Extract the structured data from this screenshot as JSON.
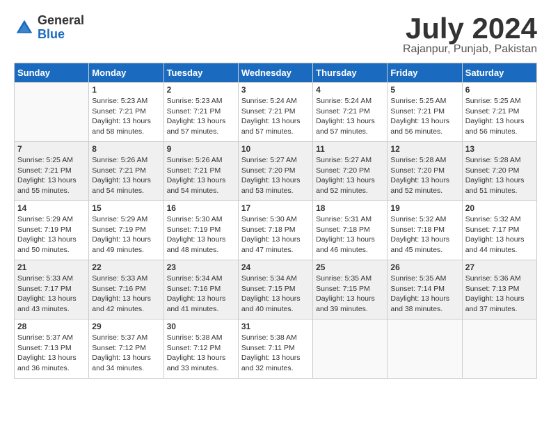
{
  "logo": {
    "general": "General",
    "blue": "Blue"
  },
  "title": {
    "month_year": "July 2024",
    "location": "Rajanpur, Punjab, Pakistan"
  },
  "days_of_week": [
    "Sunday",
    "Monday",
    "Tuesday",
    "Wednesday",
    "Thursday",
    "Friday",
    "Saturday"
  ],
  "weeks": [
    [
      {
        "day": "",
        "info": ""
      },
      {
        "day": "1",
        "info": "Sunrise: 5:23 AM\nSunset: 7:21 PM\nDaylight: 13 hours\nand 58 minutes."
      },
      {
        "day": "2",
        "info": "Sunrise: 5:23 AM\nSunset: 7:21 PM\nDaylight: 13 hours\nand 57 minutes."
      },
      {
        "day": "3",
        "info": "Sunrise: 5:24 AM\nSunset: 7:21 PM\nDaylight: 13 hours\nand 57 minutes."
      },
      {
        "day": "4",
        "info": "Sunrise: 5:24 AM\nSunset: 7:21 PM\nDaylight: 13 hours\nand 57 minutes."
      },
      {
        "day": "5",
        "info": "Sunrise: 5:25 AM\nSunset: 7:21 PM\nDaylight: 13 hours\nand 56 minutes."
      },
      {
        "day": "6",
        "info": "Sunrise: 5:25 AM\nSunset: 7:21 PM\nDaylight: 13 hours\nand 56 minutes."
      }
    ],
    [
      {
        "day": "7",
        "info": "Sunrise: 5:25 AM\nSunset: 7:21 PM\nDaylight: 13 hours\nand 55 minutes."
      },
      {
        "day": "8",
        "info": "Sunrise: 5:26 AM\nSunset: 7:21 PM\nDaylight: 13 hours\nand 54 minutes."
      },
      {
        "day": "9",
        "info": "Sunrise: 5:26 AM\nSunset: 7:21 PM\nDaylight: 13 hours\nand 54 minutes."
      },
      {
        "day": "10",
        "info": "Sunrise: 5:27 AM\nSunset: 7:20 PM\nDaylight: 13 hours\nand 53 minutes."
      },
      {
        "day": "11",
        "info": "Sunrise: 5:27 AM\nSunset: 7:20 PM\nDaylight: 13 hours\nand 52 minutes."
      },
      {
        "day": "12",
        "info": "Sunrise: 5:28 AM\nSunset: 7:20 PM\nDaylight: 13 hours\nand 52 minutes."
      },
      {
        "day": "13",
        "info": "Sunrise: 5:28 AM\nSunset: 7:20 PM\nDaylight: 13 hours\nand 51 minutes."
      }
    ],
    [
      {
        "day": "14",
        "info": "Sunrise: 5:29 AM\nSunset: 7:19 PM\nDaylight: 13 hours\nand 50 minutes."
      },
      {
        "day": "15",
        "info": "Sunrise: 5:29 AM\nSunset: 7:19 PM\nDaylight: 13 hours\nand 49 minutes."
      },
      {
        "day": "16",
        "info": "Sunrise: 5:30 AM\nSunset: 7:19 PM\nDaylight: 13 hours\nand 48 minutes."
      },
      {
        "day": "17",
        "info": "Sunrise: 5:30 AM\nSunset: 7:18 PM\nDaylight: 13 hours\nand 47 minutes."
      },
      {
        "day": "18",
        "info": "Sunrise: 5:31 AM\nSunset: 7:18 PM\nDaylight: 13 hours\nand 46 minutes."
      },
      {
        "day": "19",
        "info": "Sunrise: 5:32 AM\nSunset: 7:18 PM\nDaylight: 13 hours\nand 45 minutes."
      },
      {
        "day": "20",
        "info": "Sunrise: 5:32 AM\nSunset: 7:17 PM\nDaylight: 13 hours\nand 44 minutes."
      }
    ],
    [
      {
        "day": "21",
        "info": "Sunrise: 5:33 AM\nSunset: 7:17 PM\nDaylight: 13 hours\nand 43 minutes."
      },
      {
        "day": "22",
        "info": "Sunrise: 5:33 AM\nSunset: 7:16 PM\nDaylight: 13 hours\nand 42 minutes."
      },
      {
        "day": "23",
        "info": "Sunrise: 5:34 AM\nSunset: 7:16 PM\nDaylight: 13 hours\nand 41 minutes."
      },
      {
        "day": "24",
        "info": "Sunrise: 5:34 AM\nSunset: 7:15 PM\nDaylight: 13 hours\nand 40 minutes."
      },
      {
        "day": "25",
        "info": "Sunrise: 5:35 AM\nSunset: 7:15 PM\nDaylight: 13 hours\nand 39 minutes."
      },
      {
        "day": "26",
        "info": "Sunrise: 5:35 AM\nSunset: 7:14 PM\nDaylight: 13 hours\nand 38 minutes."
      },
      {
        "day": "27",
        "info": "Sunrise: 5:36 AM\nSunset: 7:13 PM\nDaylight: 13 hours\nand 37 minutes."
      }
    ],
    [
      {
        "day": "28",
        "info": "Sunrise: 5:37 AM\nSunset: 7:13 PM\nDaylight: 13 hours\nand 36 minutes."
      },
      {
        "day": "29",
        "info": "Sunrise: 5:37 AM\nSunset: 7:12 PM\nDaylight: 13 hours\nand 34 minutes."
      },
      {
        "day": "30",
        "info": "Sunrise: 5:38 AM\nSunset: 7:12 PM\nDaylight: 13 hours\nand 33 minutes."
      },
      {
        "day": "31",
        "info": "Sunrise: 5:38 AM\nSunset: 7:11 PM\nDaylight: 13 hours\nand 32 minutes."
      },
      {
        "day": "",
        "info": ""
      },
      {
        "day": "",
        "info": ""
      },
      {
        "day": "",
        "info": ""
      }
    ]
  ]
}
